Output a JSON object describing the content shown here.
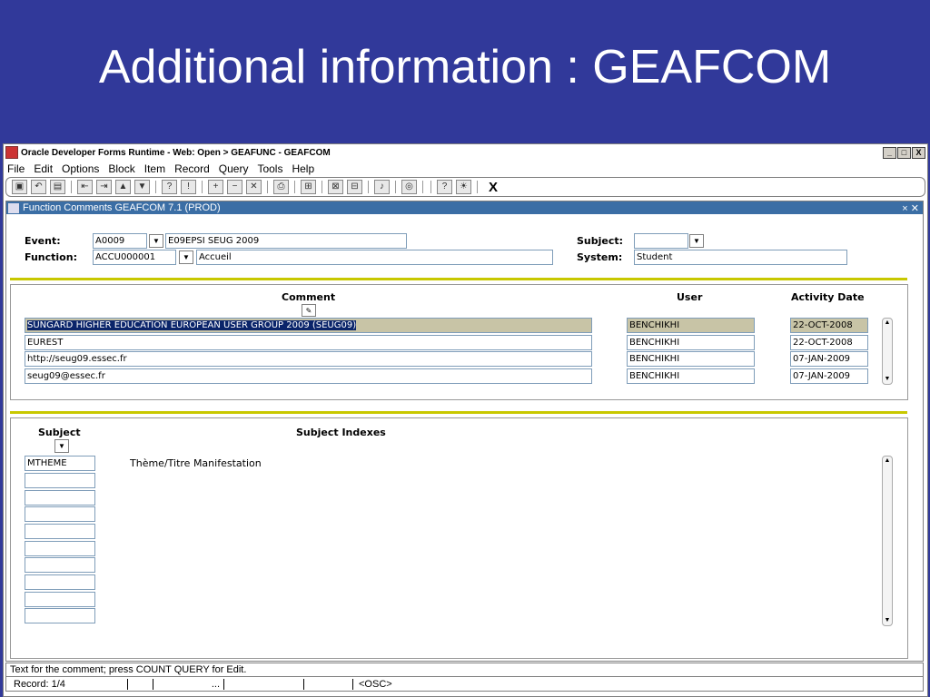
{
  "slide": {
    "title": "Additional information : GEAFCOM"
  },
  "window": {
    "title": "Oracle Developer Forms Runtime - Web:  Open > GEAFUNC - GEAFCOM",
    "buttons": [
      "_",
      "□",
      "X"
    ]
  },
  "menu": [
    "File",
    "Edit",
    "Options",
    "Block",
    "Item",
    "Record",
    "Query",
    "Tools",
    "Help"
  ],
  "toolbar": {
    "close_label": "X"
  },
  "form": {
    "title": "Function Comments  GEAFCOM  7.1  (PROD)",
    "event_label": "Event:",
    "event_code": "A0009",
    "event_desc": "E09EPSI SEUG 2009",
    "function_label": "Function:",
    "function_code": "ACCU000001",
    "function_desc": "Accueil",
    "subject_label": "Subject:",
    "subject_value": "",
    "system_label": "System:",
    "system_value": "Student"
  },
  "comments": {
    "header_comment": "Comment",
    "header_user": "User",
    "header_date": "Activity Date",
    "rows": [
      {
        "comment": "SUNGARD HIGHER EDUCATION EUROPEAN USER GROUP 2009 (SEUG09)",
        "user": "BENCHIKHI",
        "date": "22-OCT-2008"
      },
      {
        "comment": "EUREST",
        "user": "BENCHIKHI",
        "date": "22-OCT-2008"
      },
      {
        "comment": "http://seug09.essec.fr",
        "user": "BENCHIKHI",
        "date": "07-JAN-2009"
      },
      {
        "comment": "seug09@essec.fr",
        "user": "BENCHIKHI",
        "date": "07-JAN-2009"
      }
    ]
  },
  "subjects": {
    "header_subject": "Subject",
    "header_indexes": "Subject Indexes",
    "rows": [
      {
        "subject": "MTHEME",
        "index": "Thème/Titre Manifestation"
      },
      {
        "subject": "",
        "index": ""
      },
      {
        "subject": "",
        "index": ""
      },
      {
        "subject": "",
        "index": ""
      },
      {
        "subject": "",
        "index": ""
      },
      {
        "subject": "",
        "index": ""
      },
      {
        "subject": "",
        "index": ""
      },
      {
        "subject": "",
        "index": ""
      },
      {
        "subject": "",
        "index": ""
      },
      {
        "subject": "",
        "index": ""
      }
    ]
  },
  "status": {
    "hint": "Text for the comment; press COUNT QUERY for Edit.",
    "record": "Record: 1/4",
    "ellipsis": "...",
    "mode": "<OSC>"
  }
}
